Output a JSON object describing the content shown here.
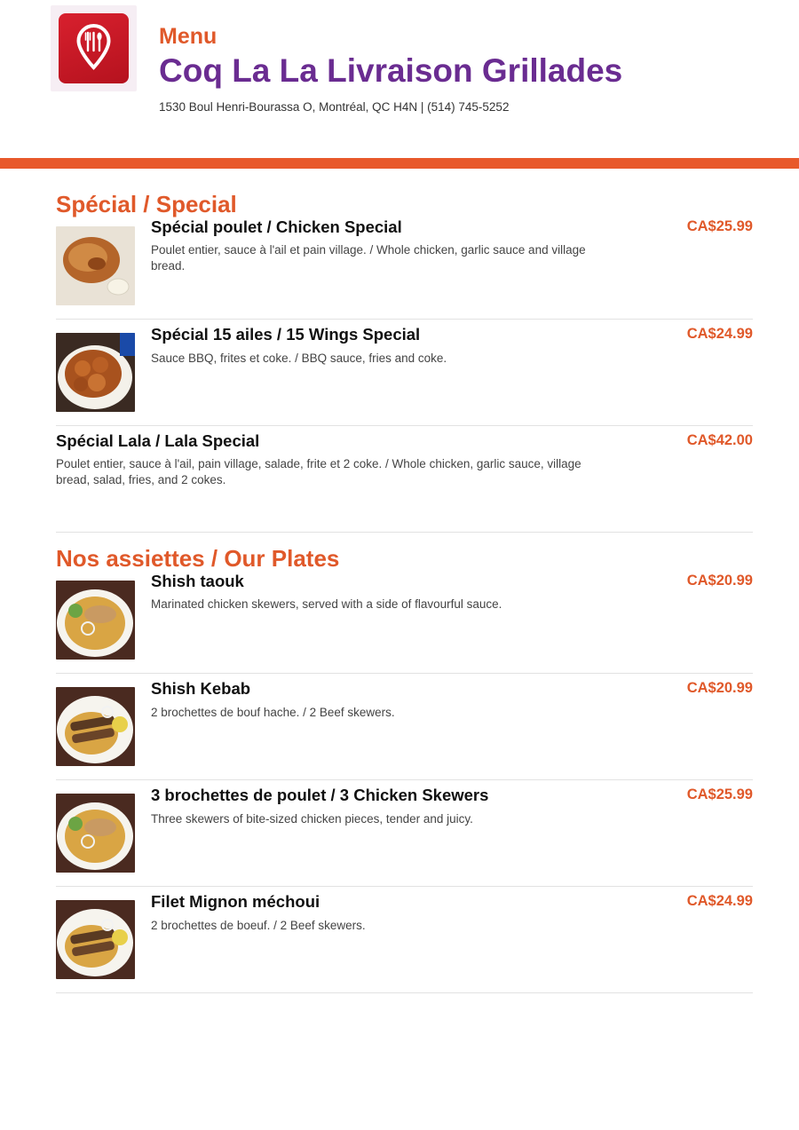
{
  "header": {
    "menu_label": "Menu",
    "restaurant_name": "Coq La La Livraison Grillades",
    "address": "1530 Boul Henri-Bourassa O, Montréal, QC H4N | (514) 745-5252"
  },
  "colors": {
    "accent": "#e0592a",
    "brand": "#6a2c91",
    "logo_red": "#d8202e"
  },
  "sections": [
    {
      "title": "Spécial / Special",
      "items": [
        {
          "name": "Spécial poulet / Chicken Special",
          "description": "Poulet entier, sauce à l'ail et pain village. / Whole chicken, garlic sauce and village bread.",
          "price": "CA$25.99"
        },
        {
          "name": "Spécial 15 ailes / 15 Wings Special",
          "description": "Sauce BBQ, frites et coke. / BBQ sauce, fries and coke.",
          "price": "CA$24.99"
        },
        {
          "name": "Spécial Lala / Lala Special",
          "description": "Poulet entier, sauce à l'ail, pain village, salade, frite et 2 coke. / Whole chicken, garlic sauce, village bread, salad, fries, and 2 cokes.",
          "price": "CA$42.00"
        }
      ]
    },
    {
      "title": "Nos assiettes / Our Plates",
      "items": [
        {
          "name": "Shish taouk",
          "description": "Marinated chicken skewers, served with a side of flavourful sauce.",
          "price": "CA$20.99"
        },
        {
          "name": "Shish Kebab",
          "description": "2 brochettes de bouf hache. / 2 Beef skewers.",
          "price": "CA$20.99"
        },
        {
          "name": "3 brochettes de poulet / 3 Chicken Skewers",
          "description": "Three skewers of bite-sized chicken pieces, tender and juicy.",
          "price": "CA$25.99"
        },
        {
          "name": "Filet Mignon méchoui",
          "description": "2 brochettes de boeuf. / 2 Beef skewers.",
          "price": "CA$24.99"
        }
      ]
    }
  ]
}
